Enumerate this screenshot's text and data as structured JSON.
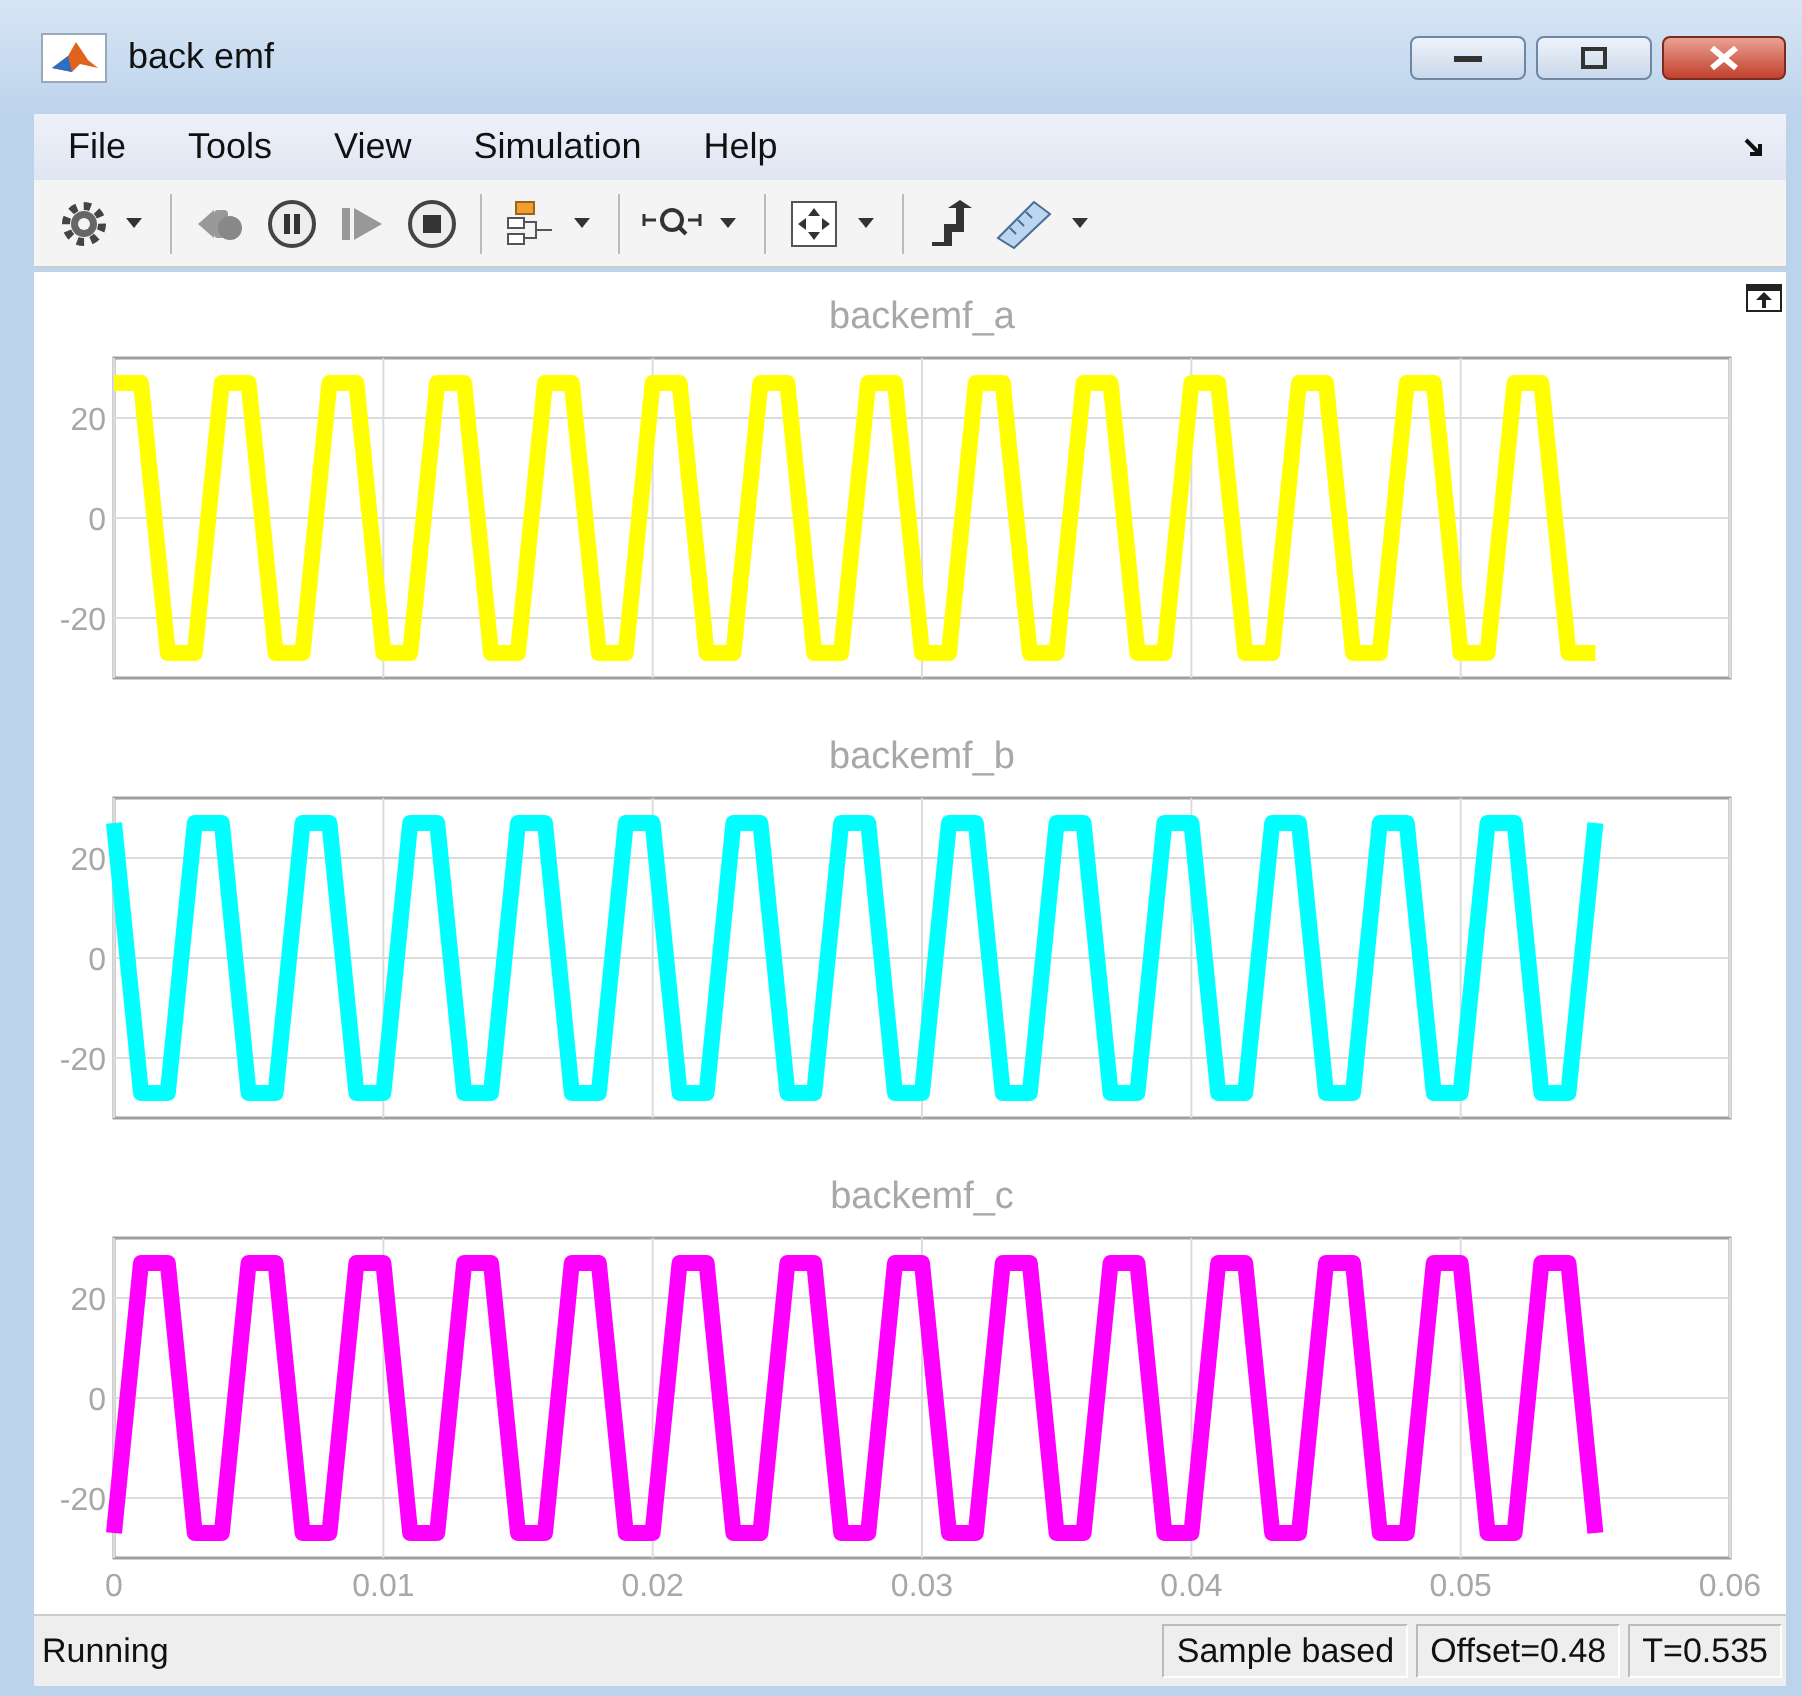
{
  "window": {
    "title": "back emf"
  },
  "menu": [
    "File",
    "Tools",
    "View",
    "Simulation",
    "Help"
  ],
  "plots": [
    {
      "chart_data": {
        "type": "line",
        "title": "backemf_a",
        "grid": true,
        "x": [
          0,
          0.001,
          0.002,
          0.003,
          0.004,
          0.005,
          0.006,
          0.007,
          0.008,
          0.009,
          0.01,
          0.011,
          0.012,
          0.013,
          0.014,
          0.015,
          0.016,
          0.017,
          0.018,
          0.019,
          0.02,
          0.021,
          0.022,
          0.023,
          0.024,
          0.025,
          0.026,
          0.027,
          0.028,
          0.029,
          0.03,
          0.031,
          0.032,
          0.033,
          0.034,
          0.035,
          0.036,
          0.037,
          0.038,
          0.039,
          0.04,
          0.041,
          0.042,
          0.043,
          0.044,
          0.045,
          0.046,
          0.047,
          0.048,
          0.049,
          0.05,
          0.051,
          0.052,
          0.053,
          0.054,
          0.055
        ],
        "series": [
          {
            "color": "#ffff00",
            "values": [
              27,
              27,
              -27,
              -27,
              27,
              27,
              -27,
              -27,
              27,
              27,
              -27,
              -27,
              27,
              27,
              -27,
              -27,
              27,
              27,
              -27,
              -27,
              27,
              27,
              -27,
              -27,
              27,
              27,
              -27,
              -27,
              27,
              27,
              -27,
              -27,
              27,
              27,
              -27,
              -27,
              27,
              27,
              -27,
              -27,
              27,
              27,
              -27,
              -27,
              27,
              27,
              -27,
              -27,
              27,
              27,
              -27,
              -27,
              27,
              27,
              -27,
              -27
            ]
          }
        ],
        "xlim": [
          0,
          0.06
        ],
        "ylim": [
          -32,
          32
        ],
        "yticks": [
          {
            "value": -20,
            "label": "-20"
          },
          {
            "value": 0,
            "label": "0"
          },
          {
            "value": 20,
            "label": "20"
          }
        ]
      }
    },
    {
      "chart_data": {
        "type": "line",
        "title": "backemf_b",
        "grid": true,
        "x": [
          0,
          0.001,
          0.002,
          0.003,
          0.004,
          0.005,
          0.006,
          0.007,
          0.008,
          0.009,
          0.01,
          0.011,
          0.012,
          0.013,
          0.014,
          0.015,
          0.016,
          0.017,
          0.018,
          0.019,
          0.02,
          0.021,
          0.022,
          0.023,
          0.024,
          0.025,
          0.026,
          0.027,
          0.028,
          0.029,
          0.03,
          0.031,
          0.032,
          0.033,
          0.034,
          0.035,
          0.036,
          0.037,
          0.038,
          0.039,
          0.04,
          0.041,
          0.042,
          0.043,
          0.044,
          0.045,
          0.046,
          0.047,
          0.048,
          0.049,
          0.05,
          0.051,
          0.052,
          0.053,
          0.054,
          0.055
        ],
        "series": [
          {
            "color": "#00ffff",
            "values": [
              27,
              -27,
              -27,
              27,
              27,
              -27,
              -27,
              27,
              27,
              -27,
              -27,
              27,
              27,
              -27,
              -27,
              27,
              27,
              -27,
              -27,
              27,
              27,
              -27,
              -27,
              27,
              27,
              -27,
              -27,
              27,
              27,
              -27,
              -27,
              27,
              27,
              -27,
              -27,
              27,
              27,
              -27,
              -27,
              27,
              27,
              -27,
              -27,
              27,
              27,
              -27,
              -27,
              27,
              27,
              -27,
              -27,
              27,
              27,
              -27,
              -27,
              27
            ]
          }
        ],
        "xlim": [
          0,
          0.06
        ],
        "ylim": [
          -32,
          32
        ],
        "yticks": [
          {
            "value": -20,
            "label": "-20"
          },
          {
            "value": 0,
            "label": "0"
          },
          {
            "value": 20,
            "label": "20"
          }
        ]
      }
    },
    {
      "chart_data": {
        "type": "line",
        "title": "backemf_c",
        "grid": true,
        "x": [
          0,
          0.001,
          0.002,
          0.003,
          0.004,
          0.005,
          0.006,
          0.007,
          0.008,
          0.009,
          0.01,
          0.011,
          0.012,
          0.013,
          0.014,
          0.015,
          0.016,
          0.017,
          0.018,
          0.019,
          0.02,
          0.021,
          0.022,
          0.023,
          0.024,
          0.025,
          0.026,
          0.027,
          0.028,
          0.029,
          0.03,
          0.031,
          0.032,
          0.033,
          0.034,
          0.035,
          0.036,
          0.037,
          0.038,
          0.039,
          0.04,
          0.041,
          0.042,
          0.043,
          0.044,
          0.045,
          0.046,
          0.047,
          0.048,
          0.049,
          0.05,
          0.051,
          0.052,
          0.053,
          0.054,
          0.055
        ],
        "series": [
          {
            "color": "#ff00ff",
            "values": [
              -27,
              27,
              27,
              -27,
              -27,
              27,
              27,
              -27,
              -27,
              27,
              27,
              -27,
              -27,
              27,
              27,
              -27,
              -27,
              27,
              27,
              -27,
              -27,
              27,
              27,
              -27,
              -27,
              27,
              27,
              -27,
              -27,
              27,
              27,
              -27,
              -27,
              27,
              27,
              -27,
              -27,
              27,
              27,
              -27,
              -27,
              27,
              27,
              -27,
              -27,
              27,
              27,
              -27,
              -27,
              27,
              27,
              -27,
              -27,
              27,
              27,
              -27
            ]
          }
        ],
        "xlim": [
          0,
          0.06
        ],
        "ylim": [
          -32,
          32
        ],
        "xticks": [
          0,
          0.01,
          0.02,
          0.03,
          0.04,
          0.05,
          0.06
        ],
        "yticks": [
          {
            "value": -20,
            "label": "-20"
          },
          {
            "value": 0,
            "label": "0"
          },
          {
            "value": 20,
            "label": "20"
          }
        ]
      }
    }
  ],
  "status_bar": {
    "text": "Running",
    "fields": [
      "Sample based",
      "Offset=0.48",
      "T=0.535"
    ]
  }
}
